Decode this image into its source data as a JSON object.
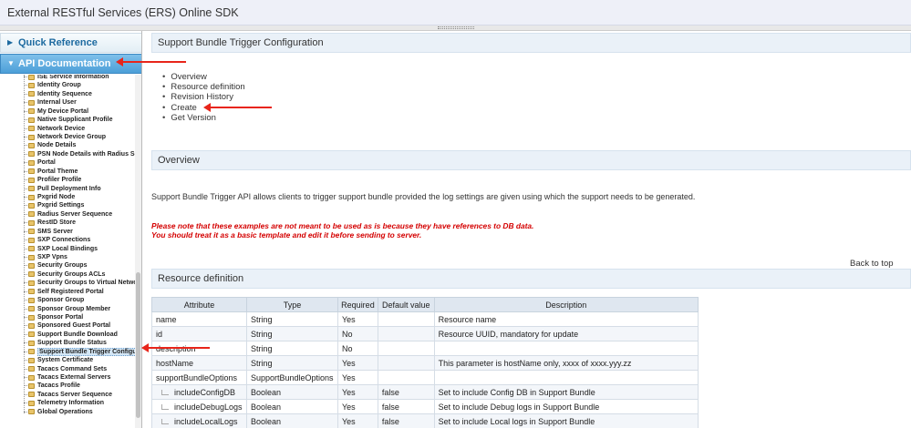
{
  "window": {
    "title": "External RESTful Services (ERS) Online SDK"
  },
  "sidebar": {
    "quick_reference": "Quick Reference",
    "api_documentation": "API Documentation",
    "tree_items": [
      "ISE Service Information",
      "Identity Group",
      "Identity Sequence",
      "Internal User",
      "My Device Portal",
      "Native Supplicant Profile",
      "Network Device",
      "Network Device Group",
      "Node Details",
      "PSN Node Details with Radius Se",
      "Portal",
      "Portal Theme",
      "Profiler Profile",
      "Pull Deployment Info",
      "Pxgrid Node",
      "Pxgrid Settings",
      "Radius Server Sequence",
      "RestID Store",
      "SMS Server",
      "SXP Connections",
      "SXP Local Bindings",
      "SXP Vpns",
      "Security Groups",
      "Security Groups ACLs",
      "Security Groups to Virtual Netwo",
      "Self Registered Portal",
      "Sponsor Group",
      "Sponsor Group Member",
      "Sponsor Portal",
      "Sponsored Guest Portal",
      "Support Bundle Download",
      "Support Bundle Status",
      "Support Bundle Trigger Configur",
      "System Certificate",
      "Tacacs Command Sets",
      "Tacacs External Servers",
      "Tacacs Profile",
      "Tacacs Server Sequence",
      "Telemetry Information",
      "Global Operations"
    ],
    "selected_index": 32
  },
  "content": {
    "page_title": "Support Bundle Trigger Configuration",
    "toc": [
      "Overview",
      "Resource definition",
      "Revision History",
      "Create",
      "Get Version"
    ],
    "overview_header": "Overview",
    "overview_text": "Support Bundle Trigger API allows clients to trigger support bundle provided the log settings are given using which the support needs to be generated.",
    "warning_line1": "Please note that these examples are not meant to be used as is because they have references to DB data.",
    "warning_line2": "You should treat it as a basic template and edit it before sending to server.",
    "back_to_top": "Back to top",
    "resource_header": "Resource definition",
    "table": {
      "headers": [
        "Attribute",
        "Type",
        "Required",
        "Default value",
        "Description"
      ],
      "rows": [
        {
          "attribute": "name",
          "type": "String",
          "required": "Yes",
          "default": "",
          "description": "Resource name",
          "sub": false
        },
        {
          "attribute": "id",
          "type": "String",
          "required": "No",
          "default": "",
          "description": "Resource UUID, mandatory for update",
          "sub": false
        },
        {
          "attribute": "description",
          "type": "String",
          "required": "No",
          "default": "",
          "description": "",
          "sub": false
        },
        {
          "attribute": "hostName",
          "type": "String",
          "required": "Yes",
          "default": "",
          "description": "This parameter is hostName only, xxxx of xxxx.yyy.zz",
          "sub": false
        },
        {
          "attribute": "supportBundleOptions",
          "type": "SupportBundleOptions",
          "required": "Yes",
          "default": "",
          "description": "",
          "sub": false
        },
        {
          "attribute": "includeConfigDB",
          "type": "Boolean",
          "required": "Yes",
          "default": "false",
          "description": "Set to include Config DB in Support Bundle",
          "sub": true
        },
        {
          "attribute": "includeDebugLogs",
          "type": "Boolean",
          "required": "Yes",
          "default": "false",
          "description": "Set to include Debug logs in Support Bundle",
          "sub": true
        },
        {
          "attribute": "includeLocalLogs",
          "type": "Boolean",
          "required": "Yes",
          "default": "false",
          "description": "Set to include Local logs in Support Bundle",
          "sub": true
        }
      ]
    }
  },
  "annotation_color": "#e8251a"
}
